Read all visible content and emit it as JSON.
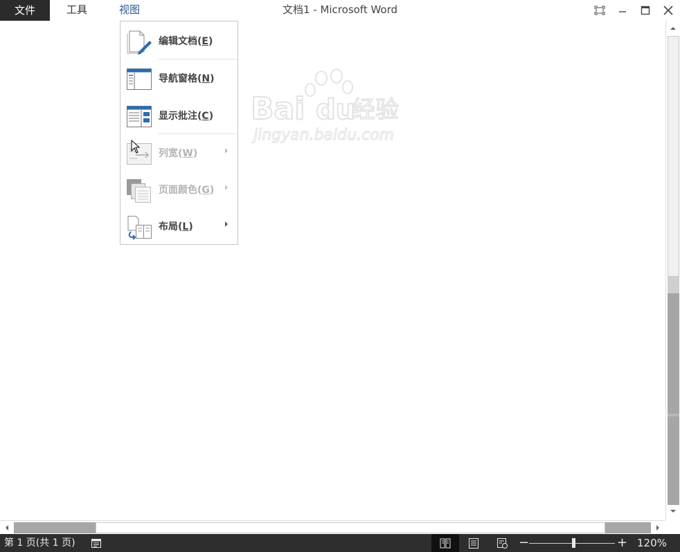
{
  "menubar": {
    "file": "文件",
    "tools": "工具",
    "view": "视图",
    "title": "文档1 - Microsoft Word"
  },
  "window_controls": [
    "fullscreen-icon",
    "minimize-icon",
    "maximize-icon",
    "close-icon"
  ],
  "view_menu": {
    "items": [
      {
        "label": "编辑文档",
        "key": "E",
        "icon": "edit-document-icon",
        "enabled": true,
        "submenu": false
      },
      {
        "label": "导航窗格",
        "key": "N",
        "icon": "navigation-pane-icon",
        "enabled": true,
        "submenu": false
      },
      {
        "label": "显示批注",
        "key": "C",
        "icon": "show-comments-icon",
        "enabled": true,
        "submenu": false
      },
      {
        "label": "列宽",
        "key": "W",
        "icon": "column-width-icon",
        "enabled": false,
        "submenu": true
      },
      {
        "label": "页面颜色",
        "key": "G",
        "icon": "page-color-icon",
        "enabled": false,
        "submenu": true
      },
      {
        "label": "布局",
        "key": "L",
        "icon": "layout-icon",
        "enabled": true,
        "submenu": true
      }
    ]
  },
  "watermark": {
    "brand": "Baidu经验",
    "url": "jingyan.baidu.com"
  },
  "statusbar": {
    "page_info": "第 1 页(共 1 页)",
    "zoom": "120%",
    "zoom_level_percent": 120
  },
  "colors": {
    "accent": "#2b579a",
    "statusbar": "#2e2e2e",
    "file_tab": "#2b2b2b"
  }
}
